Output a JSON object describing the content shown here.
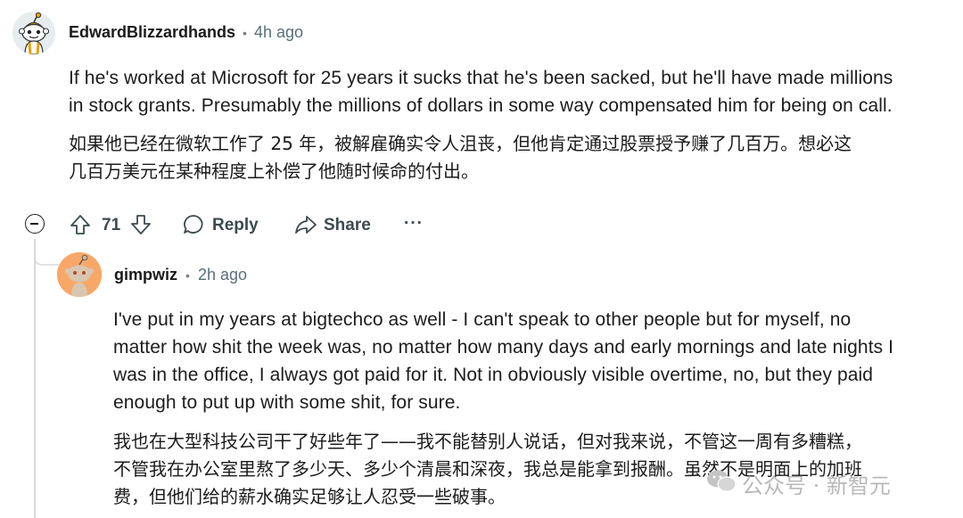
{
  "comment1": {
    "author": "EdwardBlizzardhands",
    "separator": "•",
    "time": "4h ago",
    "body_en_lines": [
      "If he's worked at Microsoft for 25 years it sucks that he's been sacked, but he'll have made millions",
      "in stock grants. Presumably the millions of dollars in some way compensated him for being on call."
    ],
    "body_cn_lines": [
      "如果他已经在微软工作了 25 年，被解雇确实令人沮丧，但他肯定通过股票授予赚了几百万。想必这",
      "几百万美元在某种程度上补偿了他随时候命的付出。"
    ],
    "votes": "71",
    "reply_label": "Reply",
    "share_label": "Share",
    "more_label": "···"
  },
  "comment2": {
    "author": "gimpwiz",
    "separator": "•",
    "time": "2h ago",
    "body_en_lines": [
      "I've put in my years at bigtechco as well - I can't speak to other people but for myself, no",
      "matter how shit the week was, no matter how many days and early mornings and late nights I",
      "was in the office, I always got paid for it. Not in obviously visible overtime, no, but they paid",
      "enough to put up with some shit, for sure."
    ],
    "body_cn_lines": [
      "我也在大型科技公司干了好些年了——我不能替别人说话，但对我来说，不管这一周有多糟糕，",
      "不管我在办公室里熬了多少天、多少个清晨和深夜，我总是能拿到报酬。虽然不是明面上的加班",
      "费，但他们给的薪水确实足够让人忍受一些破事。"
    ]
  },
  "watermark": {
    "text": "公众号 · 新智元"
  },
  "icons": {
    "upvote": "upvote-arrow-icon",
    "downvote": "downvote-arrow-icon",
    "reply": "speech-bubble-icon",
    "share": "share-arrow-icon",
    "collapse": "minus-circle-icon",
    "wechat": "wechat-logo-icon"
  }
}
